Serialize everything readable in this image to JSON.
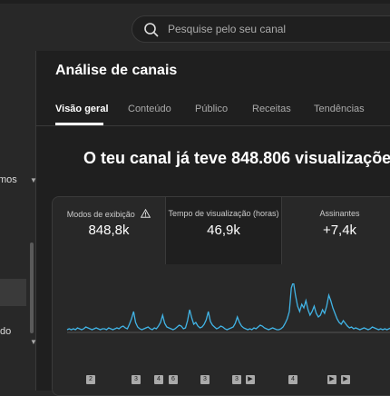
{
  "search": {
    "placeholder": "Pesquise pelo seu canal",
    "icon": "search-icon"
  },
  "sidebar": {
    "text_top": "mos",
    "text_bottom": "do"
  },
  "main": {
    "title": "Análise de canais",
    "tabs": [
      {
        "label": "Visão geral",
        "active": true
      },
      {
        "label": "Conteúdo"
      },
      {
        "label": "Público"
      },
      {
        "label": "Receitas"
      },
      {
        "label": "Tendências"
      }
    ],
    "headline": "O teu canal já teve 848.806 visualizaçõe"
  },
  "metrics": [
    {
      "label": "Modos de exibição",
      "value": "848,8k",
      "warning_icon": "warning-icon"
    },
    {
      "label": "Tempo de visualização (horas)",
      "value": "46,9k"
    },
    {
      "label": "Assinantes",
      "value": "+7,4k"
    }
  ],
  "chart_data": {
    "type": "line",
    "color": "#41b4e6",
    "values": [
      2,
      3,
      2,
      3,
      2,
      4,
      3,
      2,
      3,
      5,
      4,
      3,
      2,
      3,
      4,
      3,
      2,
      3,
      3,
      2,
      4,
      3,
      2,
      3,
      4,
      3,
      5,
      6,
      4,
      3,
      8,
      14,
      22,
      10,
      5,
      3,
      2,
      3,
      4,
      5,
      3,
      2,
      4,
      3,
      6,
      10,
      18,
      9,
      5,
      4,
      3,
      2,
      3,
      5,
      7,
      6,
      3,
      4,
      12,
      24,
      15,
      8,
      10,
      6,
      4,
      5,
      8,
      13,
      22,
      11,
      7,
      5,
      3,
      4,
      6,
      5,
      3,
      2,
      3,
      4,
      5,
      9,
      16,
      10,
      6,
      4,
      3,
      2,
      3,
      2,
      4,
      3,
      5,
      7,
      6,
      4,
      3,
      2,
      3,
      4,
      3,
      2,
      2,
      3,
      5,
      9,
      14,
      22,
      48,
      55,
      40,
      28,
      22,
      30,
      26,
      34,
      24,
      18,
      22,
      28,
      20,
      16,
      18,
      24,
      20,
      28,
      40,
      34,
      26,
      20,
      14,
      10,
      8,
      12,
      9,
      6,
      4,
      5,
      3,
      4,
      3,
      2,
      3,
      4,
      3,
      2,
      3,
      5,
      4,
      3,
      2,
      3,
      2,
      3,
      2,
      3,
      4,
      3,
      2,
      3
    ]
  },
  "markers": [
    {
      "label": "2"
    },
    {
      "label": "3"
    },
    {
      "label": "4"
    },
    {
      "label": "6"
    },
    {
      "label": "3"
    },
    {
      "label": "3"
    },
    {
      "label": "▶"
    },
    {
      "label": "4"
    },
    {
      "label": "▶"
    },
    {
      "label": "▶"
    }
  ]
}
